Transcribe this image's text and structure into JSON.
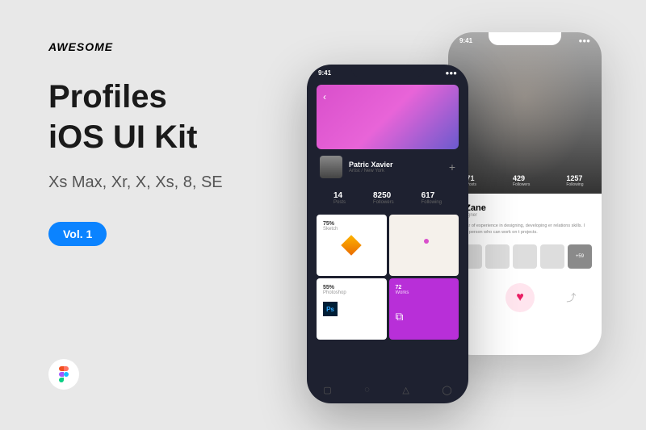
{
  "brand": "AWESOME",
  "title_line1": "Profiles",
  "title_line2": "iOS UI Kit",
  "subtitle": "Xs Max, Xr, X, Xs, 8, SE",
  "badge": "Vol. 1",
  "phone_dark": {
    "time": "9:41",
    "user_name": "Patric Xavier",
    "user_location": "Artist / New York",
    "stats": [
      {
        "value": "14",
        "label": "Posts"
      },
      {
        "value": "8250",
        "label": "Followers"
      },
      {
        "value": "617",
        "label": "Following"
      }
    ],
    "tiles": {
      "sketch": {
        "value": "75%",
        "label": "Sketch"
      },
      "photoshop": {
        "value": "55%",
        "label": "Photoshop",
        "icon_text": "Ps"
      },
      "works": {
        "value": "72",
        "label": "Works"
      }
    }
  },
  "phone_light": {
    "time": "9:41",
    "stats": [
      {
        "value": "71",
        "label": "Posts"
      },
      {
        "value": "429",
        "label": "Followers"
      },
      {
        "value": "1257",
        "label": "Following"
      }
    ],
    "name": "a Zane",
    "role": "Designer",
    "description": "e year of experience in designing, developing er relations skills. I am a person who can work on t projects.",
    "more_thumbs": "+59"
  }
}
